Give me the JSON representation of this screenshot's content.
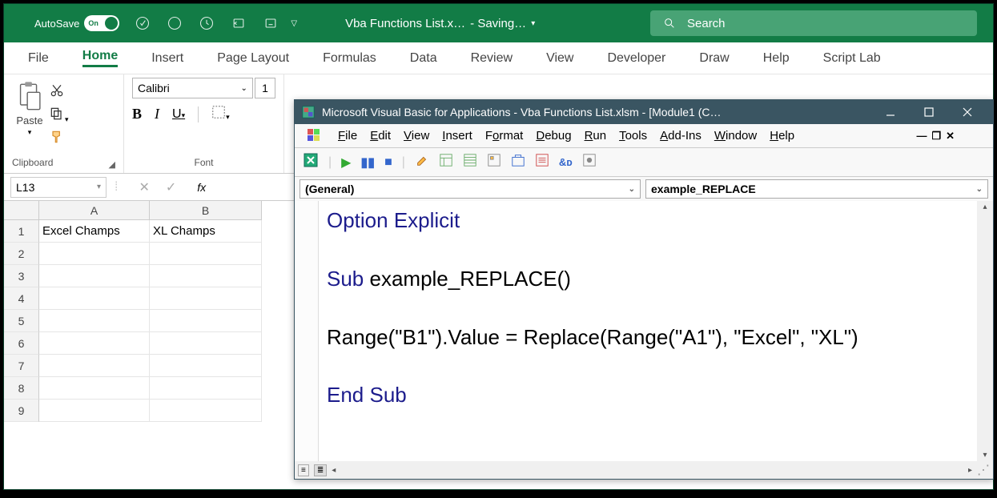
{
  "titlebar": {
    "autosave_label": "AutoSave",
    "autosave_on": "On",
    "doc_name": "Vba Functions List.x…",
    "status": "- Saving…",
    "search_placeholder": "Search"
  },
  "ribbon_tabs": [
    "File",
    "Home",
    "Insert",
    "Page Layout",
    "Formulas",
    "Data",
    "Review",
    "View",
    "Developer",
    "Draw",
    "Help",
    "Script Lab"
  ],
  "active_tab": "Home",
  "clipboard": {
    "paste_label": "Paste",
    "group_label": "Clipboard"
  },
  "font": {
    "name": "Calibri",
    "size": "1",
    "group_label": "Font"
  },
  "name_box": "L13",
  "columns": [
    {
      "label": "A",
      "width": 138
    },
    {
      "label": "B",
      "width": 140
    }
  ],
  "rows": [
    "1",
    "2",
    "3",
    "4",
    "5",
    "6",
    "7",
    "8",
    "9"
  ],
  "cells": {
    "A1": "Excel Champs",
    "B1": "XL Champs"
  },
  "vbe": {
    "title": "Microsoft Visual Basic for Applications - Vba Functions List.xlsm - [Module1 (C…",
    "menu": [
      "File",
      "Edit",
      "View",
      "Insert",
      "Format",
      "Debug",
      "Run",
      "Tools",
      "Add-Ins",
      "Window",
      "Help"
    ],
    "selector_left": "(General)",
    "selector_right": "example_REPLACE",
    "code": {
      "line1": "Option Explicit",
      "line2_kw": "Sub",
      "line2_rest": " example_REPLACE()",
      "line3": "Range(\"B1\").Value = Replace(Range(\"A1\"), \"Excel\", \"XL\")",
      "line4": "End Sub"
    }
  }
}
